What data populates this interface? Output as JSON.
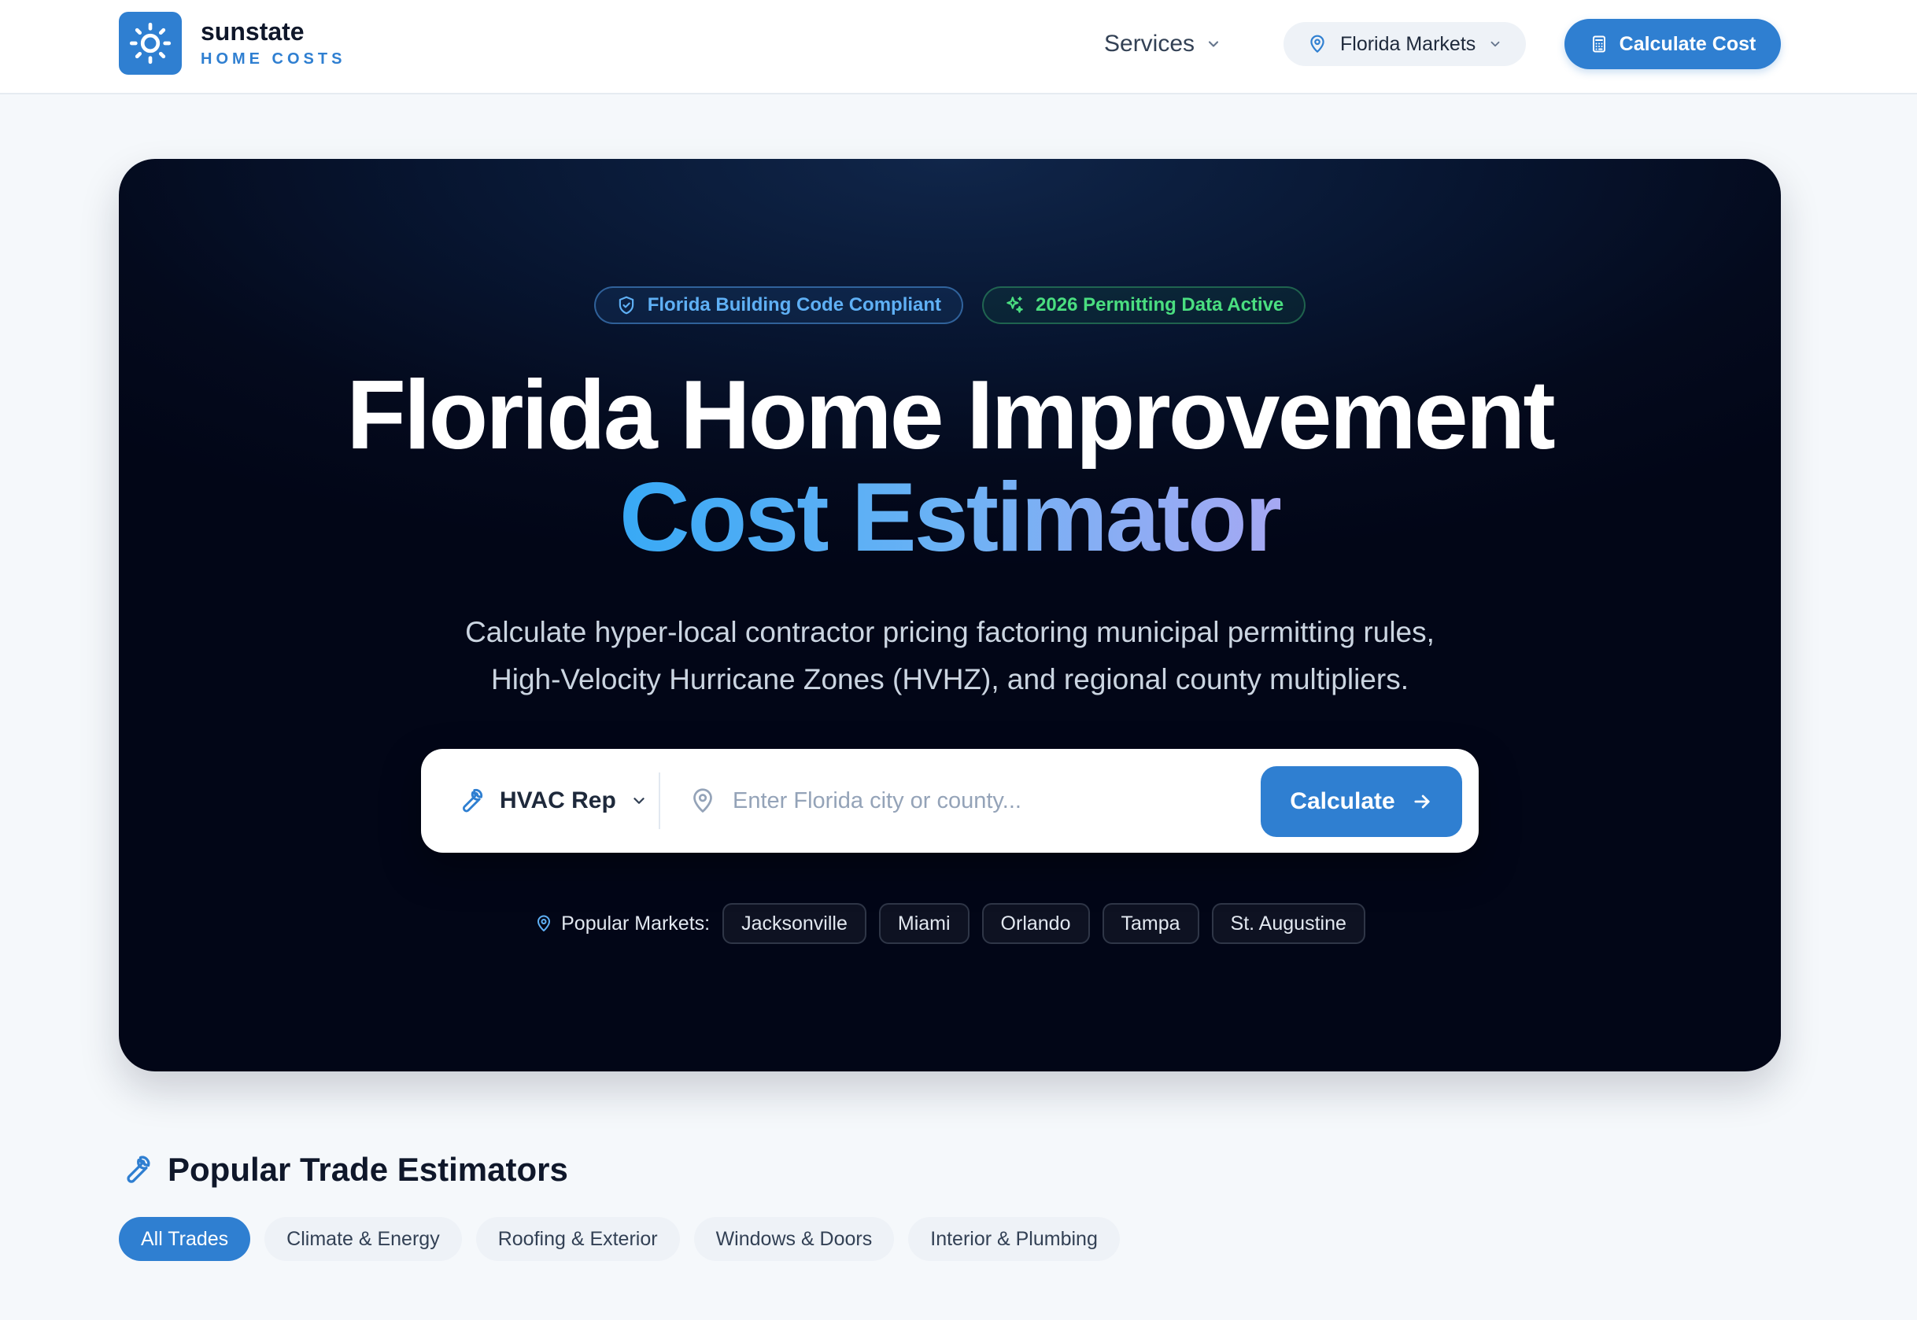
{
  "brand": {
    "name": "sunstate",
    "tagline": "HOME COSTS"
  },
  "nav": {
    "services_label": "Services",
    "markets_label": "Florida Markets",
    "cta_label": "Calculate Cost"
  },
  "hero": {
    "badges": [
      {
        "label": "Florida Building Code Compliant"
      },
      {
        "label": "2026 Permitting Data Active"
      }
    ],
    "title_line_1": "Florida Home Improvement",
    "title_line_2": "Cost Estimator",
    "subtitle_line_1": "Calculate hyper-local contractor pricing factoring municipal permitting rules,",
    "subtitle_line_2": "High-Velocity Hurricane Zones (HVHZ), and regional county multipliers.",
    "search": {
      "trade_selected": "HVAC Rep",
      "location_value": "",
      "location_placeholder": "Enter Florida city or county...",
      "button_label": "Calculate"
    },
    "popular_markets": {
      "label": "Popular Markets:",
      "items": [
        "Jacksonville",
        "Miami",
        "Orlando",
        "Tampa",
        "St. Augustine"
      ]
    }
  },
  "trades_section": {
    "title": "Popular Trade Estimators",
    "filters": [
      {
        "label": "All Trades",
        "active": true
      },
      {
        "label": "Climate & Energy",
        "active": false
      },
      {
        "label": "Roofing & Exterior",
        "active": false
      },
      {
        "label": "Windows & Doors",
        "active": false
      },
      {
        "label": "Interior & Plumbing",
        "active": false
      }
    ]
  },
  "colors": {
    "accent": "#2f7fd1",
    "hero_bg": "#020617",
    "badge_blue": "#5fb0f5",
    "badge_green": "#4ade80",
    "page_bg": "#f5f8fb"
  },
  "icons": {
    "logo": "sun-icon",
    "services": "chevron-down-icon",
    "markets": "map-pin-icon",
    "cta": "calculator-icon",
    "badge_1": "shield-check-icon",
    "badge_2": "sparkles-icon",
    "trade": "wrench-icon",
    "location": "map-pin-icon",
    "submit": "arrow-right-icon"
  }
}
